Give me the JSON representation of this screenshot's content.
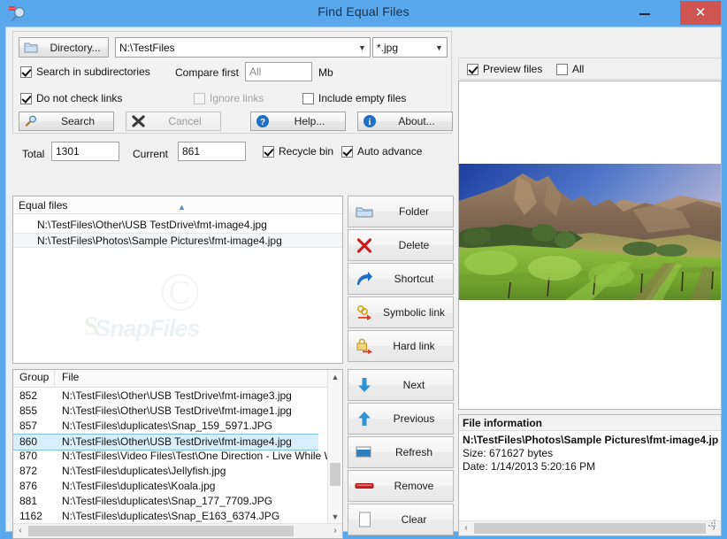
{
  "window": {
    "title": "Find Equal Files",
    "app_icon": "magnifier-icon",
    "controls": {
      "minimize": "–",
      "maximize": "☐",
      "close": "✕"
    },
    "accent_titlebar": "#5aa8ec",
    "accent_close": "#cf5454"
  },
  "search_options": {
    "directory_button": "Directory...",
    "directory_icon": "folder-icon",
    "path_value": "N:\\TestFiles",
    "path_placeholder": "",
    "mask_value": "*.jpg",
    "dropdown_arrow": "▼",
    "search_in_subdirectories": "Search in subdirectories",
    "search_in_subdirectories_checked": true,
    "compare_first_label": "Compare first",
    "compare_first_value": "All",
    "compare_first_unit": "Mb",
    "do_not_check_links": "Do not check links",
    "do_not_check_links_checked": true,
    "ignore_links": "Ignore links",
    "ignore_links_checked": false,
    "ignore_links_enabled": false,
    "include_empty_files": "Include empty files",
    "include_empty_files_checked": false,
    "buttons": {
      "search": "Search",
      "search_icon": "magnifier-icon",
      "cancel": "Cancel",
      "cancel_icon": "x-mark-icon",
      "cancel_enabled": false,
      "help": "Help...",
      "help_icon": "question-circle-icon",
      "about": "About...",
      "about_icon": "info-circle-icon"
    }
  },
  "counters": {
    "total_label": "Total",
    "total_value": "1301",
    "current_label": "Current",
    "current_value": "861",
    "recycle_bin": "Recycle bin",
    "recycle_bin_checked": true,
    "auto_advance": "Auto advance",
    "auto_advance_checked": true
  },
  "equal_files": {
    "header": "Equal files",
    "sort_marker": "▲",
    "rows": [
      {
        "path": "N:\\TestFiles\\Other\\USB TestDrive\\fmt-image4.jpg",
        "selected": false
      },
      {
        "path": "N:\\TestFiles\\Photos\\Sample Pictures\\fmt-image4.jpg",
        "selected": true
      }
    ],
    "watermark_c": "©",
    "watermark_s": "S",
    "watermark_text": "SnapFiles"
  },
  "group_list": {
    "columns": [
      "Group",
      "File"
    ],
    "rows": [
      {
        "group": "852",
        "file": "N:\\TestFiles\\Other\\USB TestDrive\\fmt-image3.jpg",
        "selected": false
      },
      {
        "group": "855",
        "file": "N:\\TestFiles\\Other\\USB TestDrive\\fmt-image1.jpg",
        "selected": false
      },
      {
        "group": "857",
        "file": "N:\\TestFiles\\duplicates\\Snap_159_5971.JPG",
        "selected": false
      },
      {
        "group": "860",
        "file": "N:\\TestFiles\\Other\\USB TestDrive\\fmt-image4.jpg",
        "selected": true
      },
      {
        "group": "870",
        "file": "N:\\TestFiles\\Video Files\\Test\\One Direction - Live While We're.",
        "selected": false
      },
      {
        "group": "872",
        "file": "N:\\TestFiles\\duplicates\\Jellyfish.jpg",
        "selected": false
      },
      {
        "group": "876",
        "file": "N:\\TestFiles\\duplicates\\Koala.jpg",
        "selected": false
      },
      {
        "group": "881",
        "file": "N:\\TestFiles\\duplicates\\Snap_177_7709.JPG",
        "selected": false
      },
      {
        "group": "1162",
        "file": "N:\\TestFiles\\duplicates\\Snap_E163_6374.JPG",
        "selected": false
      }
    ],
    "scroll_up": "▲",
    "scroll_down": "▼",
    "scroll_left": "‹",
    "scroll_right": "›"
  },
  "actions": [
    {
      "label": "Folder",
      "icon": "folder-icon"
    },
    {
      "label": "Delete",
      "icon": "red-x-icon"
    },
    {
      "label": "Shortcut",
      "icon": "shortcut-arrow-icon"
    },
    {
      "label": "Symbolic link",
      "icon": "symbolic-link-icon"
    },
    {
      "label": "Hard link",
      "icon": "hard-link-lock-icon"
    },
    {
      "label": "Next",
      "icon": "arrow-down-icon"
    },
    {
      "label": "Previous",
      "icon": "arrow-up-icon"
    },
    {
      "label": "Refresh",
      "icon": "window-refresh-icon"
    },
    {
      "label": "Remove",
      "icon": "red-bar-icon"
    },
    {
      "label": "Clear",
      "icon": "blank-page-icon"
    }
  ],
  "preview": {
    "preview_files": "Preview files",
    "preview_files_checked": true,
    "all": "All",
    "all_checked": false,
    "image_alt": "mountain-vineyard-photo"
  },
  "file_information": {
    "header": "File information",
    "path": "N:\\TestFiles\\Photos\\Sample Pictures\\fmt-image4.jp",
    "size": "Size: 671627 bytes",
    "date": "Date:  1/14/2013 5:20:16 PM",
    "scroll_left": "‹",
    "scroll_right": "›"
  }
}
